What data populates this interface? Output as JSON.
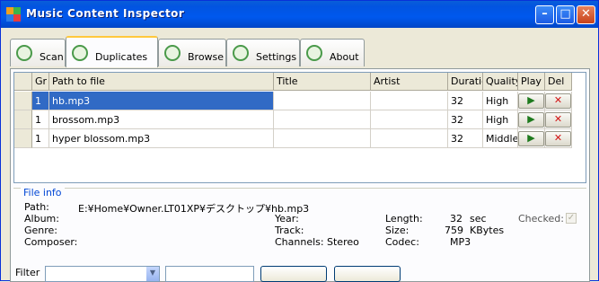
{
  "window": {
    "title": "Music Content Inspector"
  },
  "tabs": [
    "Scan",
    "Duplicates",
    "Browse",
    "Settings",
    "About"
  ],
  "grid": {
    "columns": [
      "Gr",
      "Path to file",
      "Title",
      "Artist",
      "Duration",
      "Quality",
      "Play",
      "Del"
    ],
    "rows": [
      {
        "group": "1",
        "path": "hb.mp3",
        "title": "",
        "artist": "",
        "duration": "32",
        "quality": "High"
      },
      {
        "group": "1",
        "path": "brossom.mp3",
        "title": "",
        "artist": "",
        "duration": "32",
        "quality": "High"
      },
      {
        "group": "1",
        "path": "hyper blossom.mp3",
        "title": "",
        "artist": "",
        "duration": "32",
        "quality": "Middle"
      }
    ]
  },
  "file_info": {
    "title": "File info",
    "labels": {
      "path": "Path:",
      "album": "Album:",
      "genre": "Genre:",
      "composer": "Composer:",
      "year": "Year:",
      "track": "Track:",
      "channels": "Channels:",
      "length": "Length:",
      "size": "Size:",
      "codec": "Codec:",
      "checked": "Checked:"
    },
    "values": {
      "path": "E:¥Home¥Owner.LT01XP¥デスクトップ¥hb.mp3",
      "channels": "Stereo",
      "length": "32",
      "length_unit": "sec",
      "size": "759",
      "size_unit": "KBytes",
      "codec": "MP3"
    }
  },
  "filter": {
    "label": "Filter"
  },
  "colors": {
    "accent": "#316ac5",
    "titlebar": "#0058ee",
    "tab_highlight": "#ffc83c",
    "info_title": "#0046d5"
  }
}
